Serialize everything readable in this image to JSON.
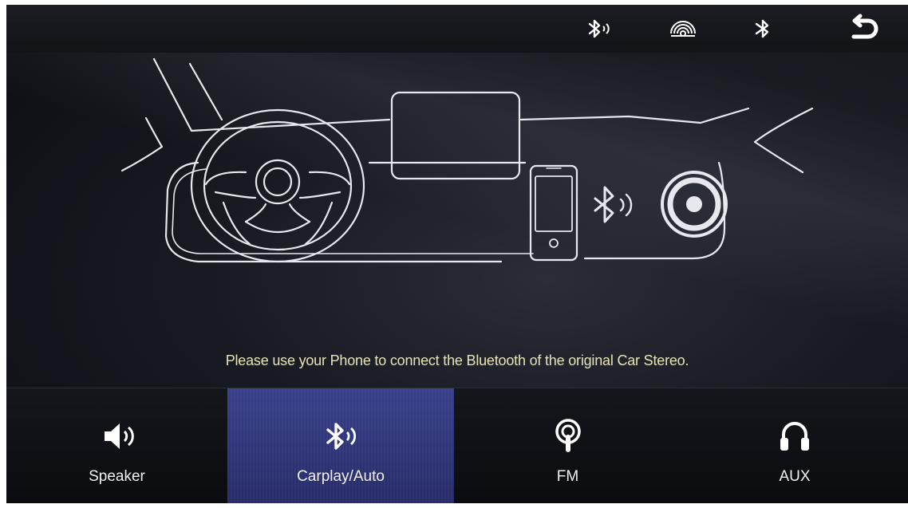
{
  "topbar": {
    "icons": [
      "bluetooth-audio-icon",
      "wireless-signal-icon",
      "bluetooth-icon",
      "back-icon"
    ]
  },
  "message": "Please use your Phone to connect the Bluetooth of the original Car Stereo.",
  "tabs": [
    {
      "label": "Speaker",
      "icon": "speaker-icon",
      "active": false
    },
    {
      "label": "Carplay/Auto",
      "icon": "bluetooth-audio-icon",
      "active": true
    },
    {
      "label": "FM",
      "icon": "radio-icon",
      "active": false
    },
    {
      "label": "AUX",
      "icon": "headphones-icon",
      "active": false
    }
  ],
  "colors": {
    "message_text": "#e8e3b6",
    "active_tab": "#363d86",
    "line_art": "#e6e8ee"
  }
}
